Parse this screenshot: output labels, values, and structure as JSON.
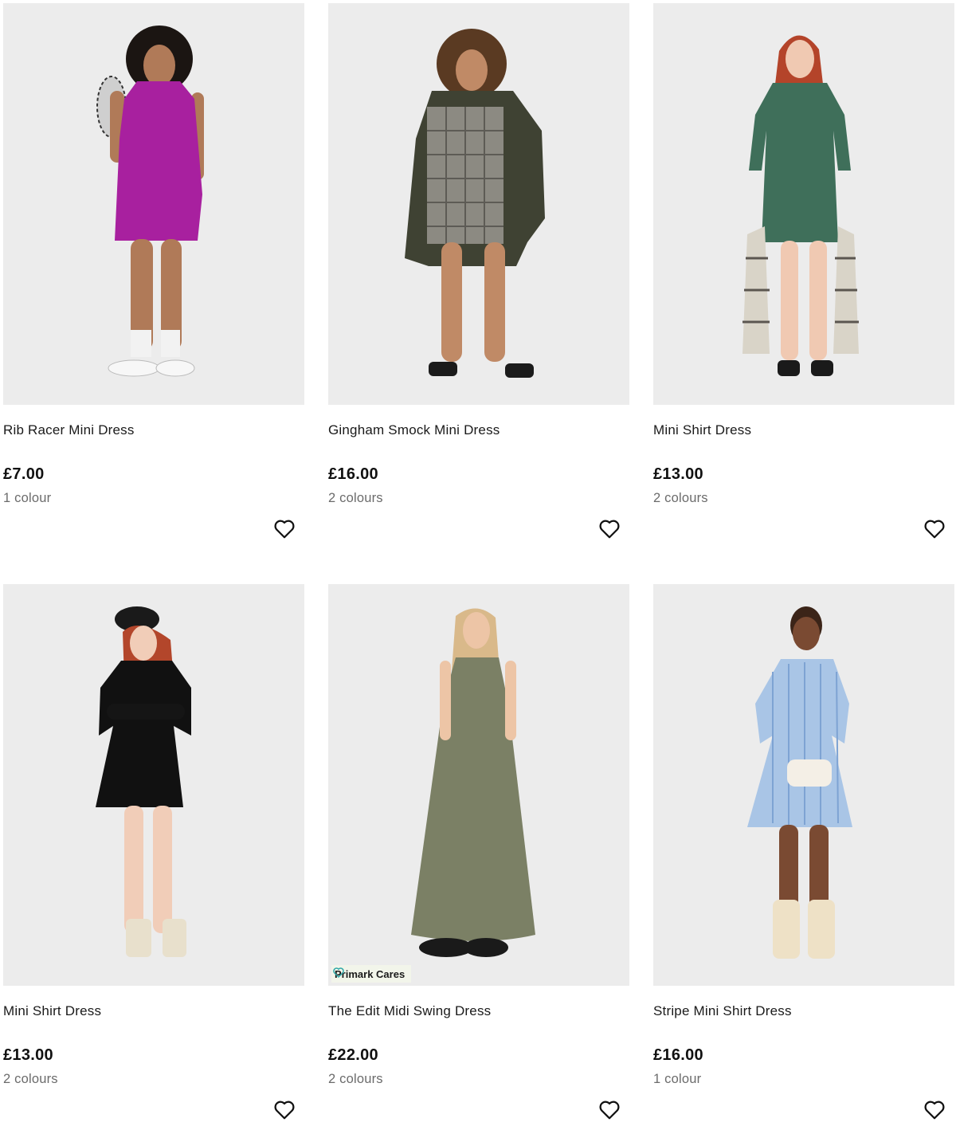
{
  "products": [
    {
      "title": "Rib Racer Mini Dress",
      "price": "£7.00",
      "colours": "1 colour",
      "image_alt": "Model wearing a magenta ribbed racer mini dress"
    },
    {
      "title": "Gingham Smock Mini Dress",
      "price": "£16.00",
      "colours": "2 colours",
      "image_alt": "Model wearing a gingham smock mini dress with khaki parka"
    },
    {
      "title": "Mini Shirt Dress",
      "price": "£13.00",
      "colours": "2 colours",
      "image_alt": "Model wearing a green mini shirt dress holding a check shirt"
    },
    {
      "title": "Mini Shirt Dress",
      "price": "£13.00",
      "colours": "2 colours",
      "image_alt": "Model wearing a black mini shirt dress and beret"
    },
    {
      "title": "The Edit Midi Swing Dress",
      "price": "£22.00",
      "colours": "2 colours",
      "image_alt": "Model wearing a khaki sleeveless midi swing dress",
      "badge": "Primark Cares"
    },
    {
      "title": "Stripe Mini Shirt Dress",
      "price": "£16.00",
      "colours": "1 colour",
      "image_alt": "Model wearing a blue stripe mini shirt dress"
    }
  ],
  "icons": {
    "favourite": "heart-outline-icon",
    "badge": "heart-leaf-icon"
  },
  "colors": {
    "image_background": "#ececec",
    "text": "#1a1a1a",
    "muted_text": "#6b6b6b",
    "badge_background": "#f2f5ea",
    "badge_icon": "#2fa7a7"
  }
}
